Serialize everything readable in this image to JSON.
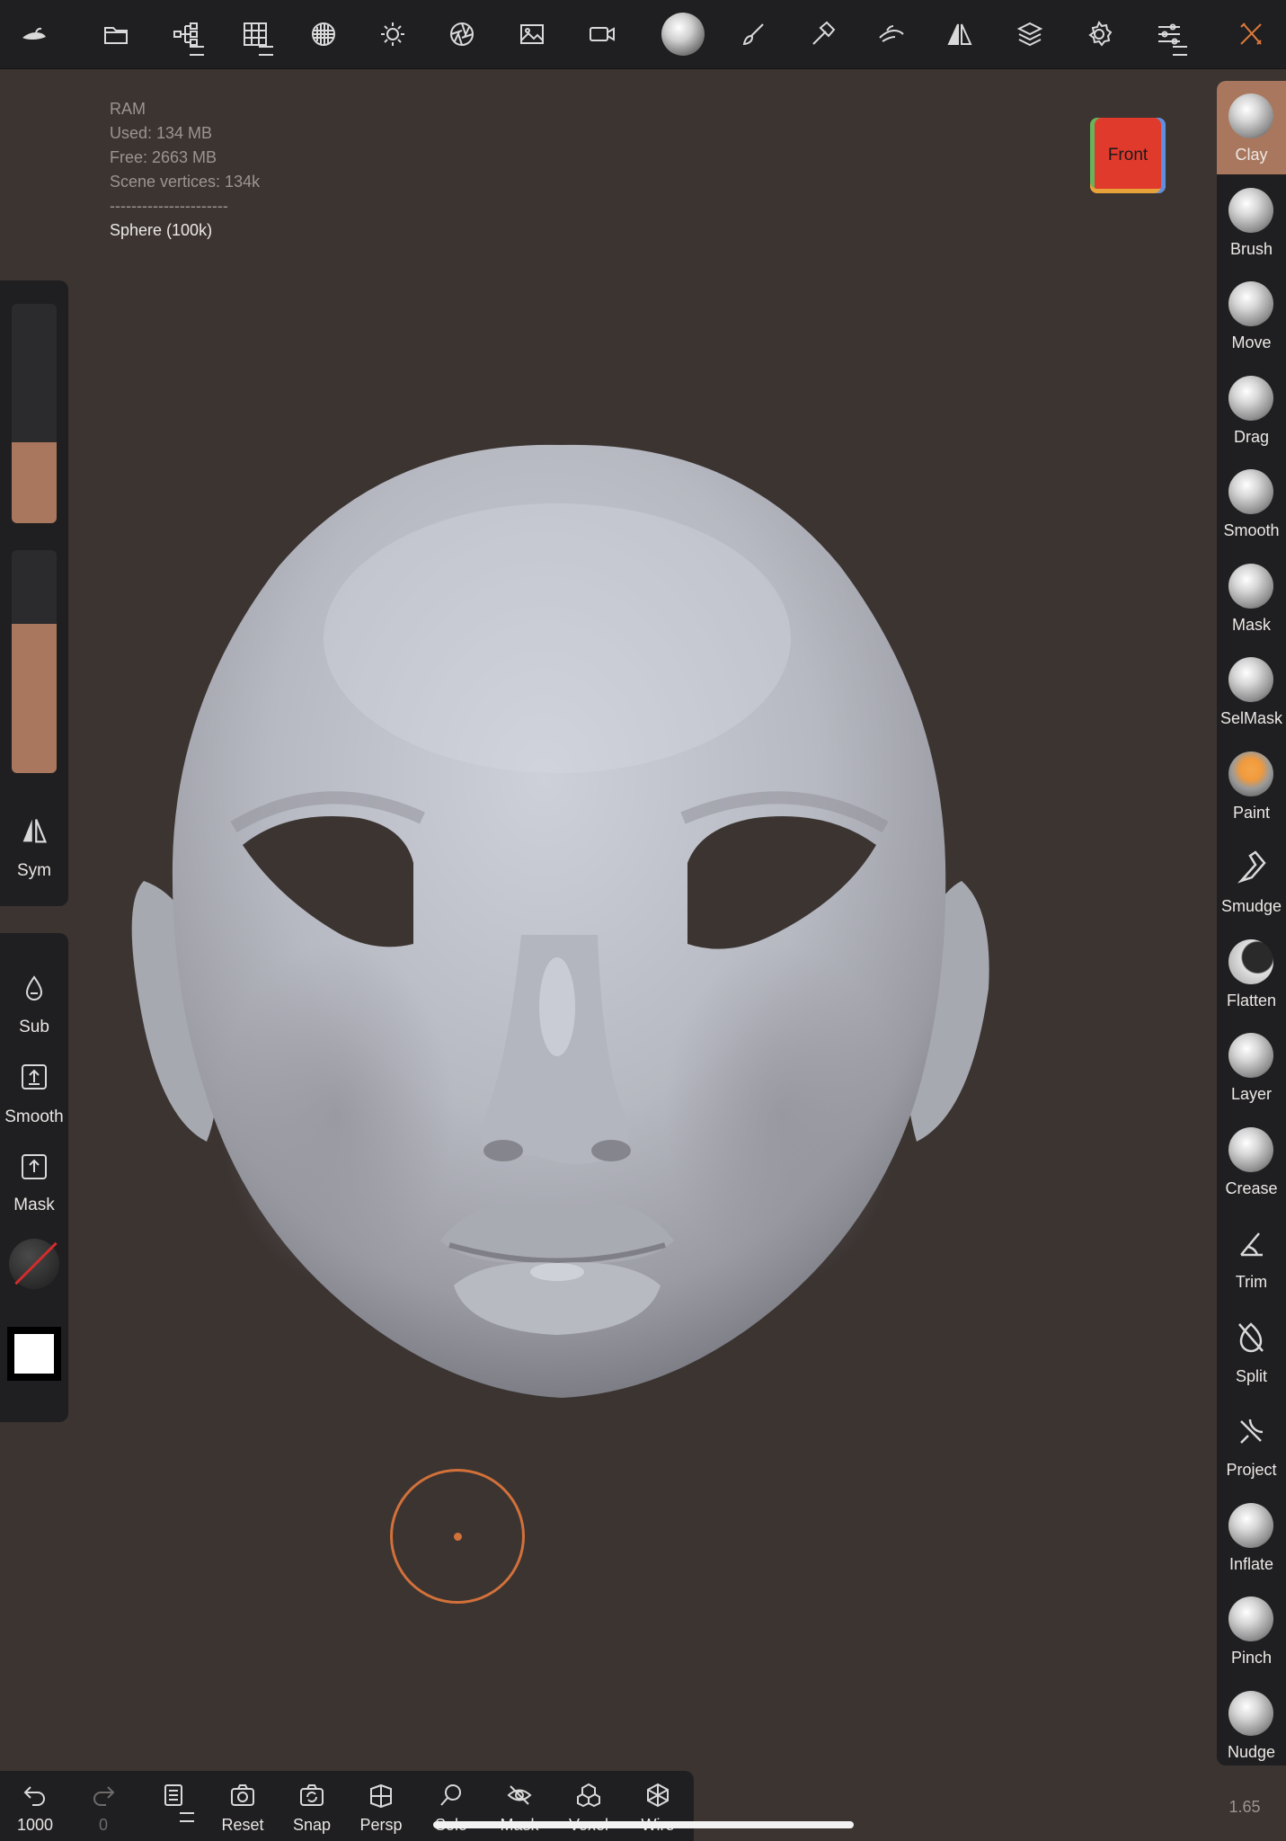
{
  "stats": {
    "label": "RAM",
    "used": "Used: 134 MB",
    "free": "Free: 2663 MB",
    "vertices": "Scene vertices: 134k",
    "divider": "----------------------",
    "selected_object": "Sphere (100k)"
  },
  "view_cube": {
    "label": "Front"
  },
  "topbar": {
    "icons": [
      "logo-icon",
      "files-icon",
      "scene-tree-icon",
      "topology-icon",
      "remesh-icon",
      "lighting-icon",
      "camera-shutter-icon",
      "image-icon",
      "video-icon",
      "material-icon",
      "paint-brush-icon",
      "hammer-icon",
      "sculpt-hand-icon",
      "symmetry-icon",
      "layers-icon",
      "settings-icon",
      "sliders-icon",
      "tools-icon"
    ],
    "accent": "#e07a3a"
  },
  "left_panel": {
    "radius_fraction": 0.37,
    "intensity_fraction": 0.67,
    "sym_label": "Sym",
    "sub_label": "Sub",
    "smooth_label": "Smooth",
    "mask_label": "Mask"
  },
  "brushes": [
    {
      "name": "Clay",
      "active": true
    },
    {
      "name": "Brush",
      "active": false
    },
    {
      "name": "Move",
      "active": false
    },
    {
      "name": "Drag",
      "active": false
    },
    {
      "name": "Smooth",
      "active": false
    },
    {
      "name": "Mask",
      "active": false
    },
    {
      "name": "SelMask",
      "active": false
    },
    {
      "name": "Paint",
      "active": false
    },
    {
      "name": "Smudge",
      "active": false
    },
    {
      "name": "Flatten",
      "active": false
    },
    {
      "name": "Layer",
      "active": false
    },
    {
      "name": "Crease",
      "active": false
    },
    {
      "name": "Trim",
      "active": false
    },
    {
      "name": "Split",
      "active": false
    },
    {
      "name": "Project",
      "active": false
    },
    {
      "name": "Inflate",
      "active": false
    },
    {
      "name": "Pinch",
      "active": false
    },
    {
      "name": "Nudge",
      "active": false
    }
  ],
  "bottombar": {
    "undo_count": "1000",
    "redo_count": "0",
    "reset_label": "Reset",
    "snap_label": "Snap",
    "persp_label": "Persp",
    "solo_label": "Solo",
    "mask_label": "Mask",
    "voxel_label": "Voxel",
    "wire_label": "Wire",
    "zoom_value": "1.65"
  },
  "colors": {
    "viewport_bg": "#3b3431",
    "panel_bg": "#1f1f21",
    "accent_brown": "#a9775d",
    "cursor_orange": "#d2713a"
  }
}
